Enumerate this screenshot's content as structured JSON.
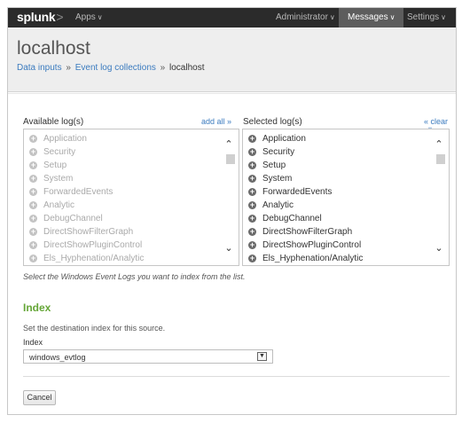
{
  "topbar": {
    "logo_main": "splunk",
    "logo_suffix": ">",
    "apps": "Apps",
    "administrator": "Administrator",
    "messages": "Messages",
    "settings": "Settings",
    "caret": "∨"
  },
  "header": {
    "title": "localhost",
    "breadcrumb": {
      "item1": "Data inputs",
      "item2": "Event log collections",
      "current": "localhost",
      "separator": "»"
    }
  },
  "available": {
    "label": "Available log(s)",
    "add_all": "add all »",
    "items": [
      "Application",
      "Security",
      "Setup",
      "System",
      "ForwardedEvents",
      "Analytic",
      "DebugChannel",
      "DirectShowFilterGraph",
      "DirectShowPluginControl",
      "Els_Hyphenation/Analytic"
    ]
  },
  "selected": {
    "label": "Selected log(s)",
    "clear_all": "« clear all",
    "items": [
      "Application",
      "Security",
      "Setup",
      "System",
      "ForwardedEvents",
      "Analytic",
      "DebugChannel",
      "DirectShowFilterGraph",
      "DirectShowPluginControl",
      "Els_Hyphenation/Analytic"
    ]
  },
  "help_text": "Select the Windows Event Logs you want to index from the list.",
  "index_section": {
    "title": "Index",
    "description": "Set the destination index for this source.",
    "field_label": "Index",
    "selected_value": "windows_evtlog"
  },
  "cancel_label": "Cancel",
  "colors": {
    "topbar": "#2b2b2b",
    "link": "#3b7bbf",
    "section_title": "#65a637",
    "header_bg": "#eeeeee"
  }
}
